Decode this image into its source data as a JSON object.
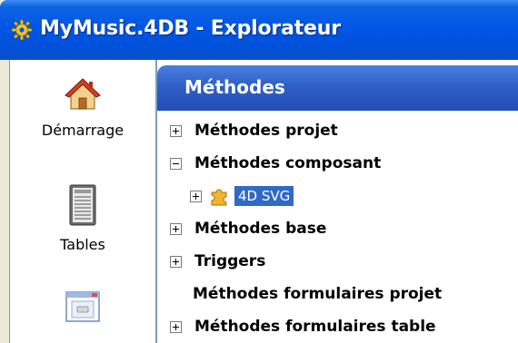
{
  "window": {
    "title": "MyMusic.4DB - Explorateur"
  },
  "sidebar": {
    "items": [
      {
        "label": "Démarrage",
        "icon": "home-icon"
      },
      {
        "label": "Tables",
        "icon": "tables-icon"
      },
      {
        "label": "",
        "icon": "forms-icon"
      }
    ]
  },
  "panel": {
    "title": "Méthodes",
    "tree": [
      {
        "label": "Méthodes projet",
        "expander": "plus"
      },
      {
        "label": "Méthodes composant",
        "expander": "minus"
      },
      {
        "label": "4D SVG",
        "expander": "plus",
        "icon": "puzzle-icon",
        "selected": true
      },
      {
        "label": "Méthodes base",
        "expander": "plus"
      },
      {
        "label": "Triggers",
        "expander": "plus"
      },
      {
        "label": "Méthodes formulaires projet",
        "expander": "none"
      },
      {
        "label": "Méthodes formulaires table",
        "expander": "plus"
      }
    ]
  },
  "colors": {
    "titlebar": "#0055e5",
    "panel_header": "#2f5fc7",
    "selection": "#316ac5"
  }
}
